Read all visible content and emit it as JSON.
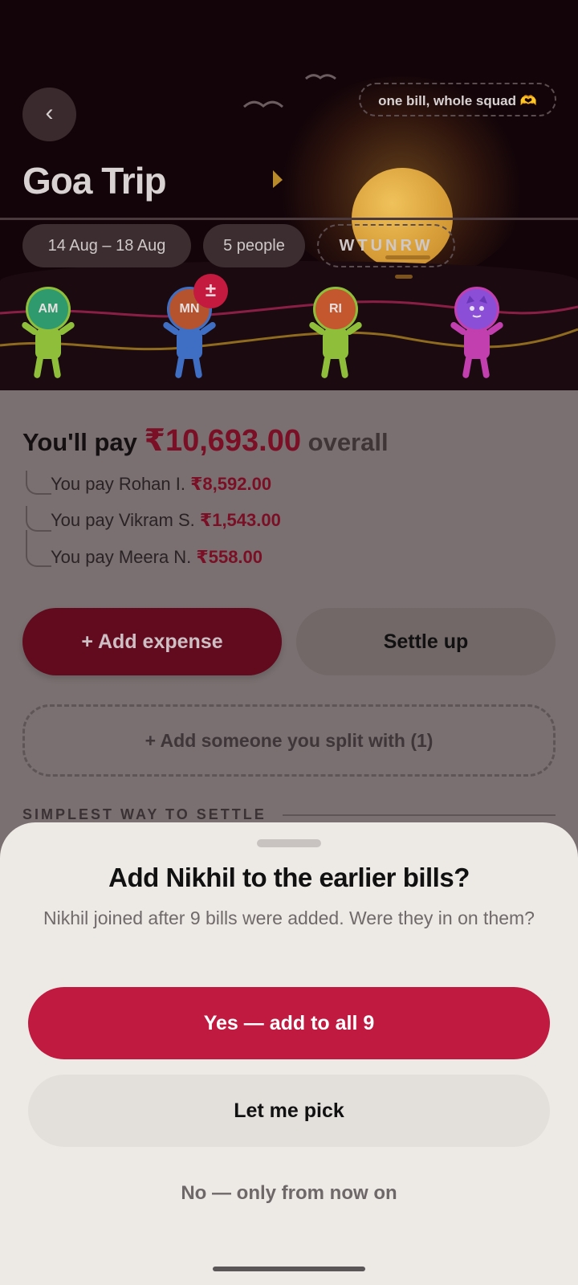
{
  "header": {
    "back_label": "‹",
    "tagline": "one bill, whole squad 🫶",
    "title": "Goa Trip",
    "chips": {
      "dates": "14 Aug – 18 Aug",
      "people": "5 people",
      "code": "WTUNRW"
    },
    "members": [
      {
        "initials": "AM",
        "color": "#2e9a6e",
        "body_color": "#8fbf3a"
      },
      {
        "initials": "MN",
        "color": "#b5532e",
        "body_color": "#3f6fc4"
      },
      {
        "initials": "RI",
        "color": "#c4572e",
        "body_color": "#8fbf3a"
      },
      {
        "initials": "",
        "color": "#8a4fd6",
        "body_color": "#c23fb0",
        "icon": "cat-face-icon"
      }
    ],
    "settle_badge": "±"
  },
  "summary": {
    "prefix": "You'll pay",
    "amount": "₹10,693.00",
    "suffix": "overall",
    "lines": [
      {
        "text": "You pay Rohan I.",
        "amount": "₹8,592.00"
      },
      {
        "text": "You pay Vikram S.",
        "amount": "₹1,543.00"
      },
      {
        "text": "You pay Meera N.",
        "amount": "₹558.00"
      }
    ]
  },
  "actions": {
    "add_expense": "+ Add expense",
    "settle_up": "Settle up",
    "add_person": "+ Add someone you split with (1)"
  },
  "section": {
    "settle_title": "SIMPLEST WAY TO SETTLE"
  },
  "sheet": {
    "title": "Add Nikhil to the earlier bills?",
    "subtitle": "Nikhil joined after 9 bills were added. Were they in on them?",
    "yes": "Yes — add to all 9",
    "pick": "Let me pick",
    "no": "No — only from now on"
  },
  "colors": {
    "accent": "#c01a41",
    "amount": "#7a0f26"
  }
}
